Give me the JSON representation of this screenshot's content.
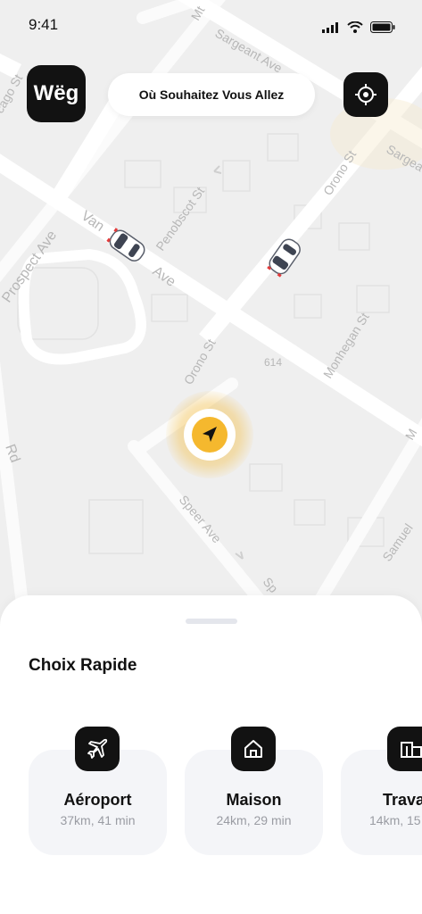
{
  "status_bar": {
    "time": "9:41"
  },
  "brand": {
    "logo_text": "Wëg"
  },
  "search": {
    "label": "Où Souhaitez Vous Allez"
  },
  "map": {
    "streets": [
      "Mt",
      "Sargeant Ave",
      "Sargea",
      "Penobscot St",
      "Orono St",
      "Van",
      "Ave",
      "Prospect Ave",
      "Monhegan St",
      "614",
      "Orono St",
      "Speer Ave",
      "Samuel",
      "Rd",
      "M",
      "cago St",
      "Sp"
    ]
  },
  "quick": {
    "title": "Choix Rapide",
    "items": [
      {
        "title": "Aéroport",
        "subtitle": "37km, 41 min",
        "icon": "airplane-icon"
      },
      {
        "title": "Maison",
        "subtitle": "24km, 29 min",
        "icon": "home-icon"
      },
      {
        "title": "Trava",
        "subtitle": "14km, 15",
        "icon": "building-icon"
      }
    ]
  },
  "colors": {
    "accent": "#f5b82e",
    "dark": "#121212",
    "card_bg": "#f4f5f8"
  }
}
